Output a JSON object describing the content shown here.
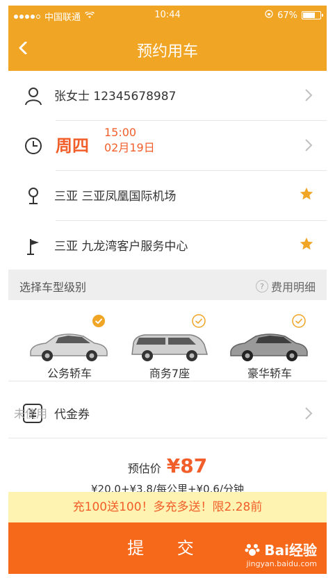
{
  "status_bar": {
    "carrier": "中国联通",
    "time": "10:44",
    "battery": "67%",
    "battery_level": 0.67
  },
  "header": {
    "title": "预约用车"
  },
  "rows": {
    "contact": {
      "text": "张女士  12345678987"
    },
    "datetime": {
      "weekday": "周四",
      "time": "15:00",
      "date": "02月19日"
    },
    "pickup": {
      "text": "三亚  三亚凤凰国际机场"
    },
    "dropoff": {
      "text": "三亚  九龙湾客户服务中心"
    }
  },
  "section": {
    "label": "选择车型级别",
    "fee_link": "费用明细"
  },
  "cars": [
    {
      "label": "公务轿车",
      "selected": true
    },
    {
      "label": "商务7座",
      "selected": false
    },
    {
      "label": "豪华轿车",
      "selected": false
    }
  ],
  "voucher": {
    "label": "代金券",
    "status": "未使用"
  },
  "estimate": {
    "label": "预估价",
    "price": "¥87",
    "formula": "¥20.0+¥3.8/每公里+¥0.6/分钟"
  },
  "promo": {
    "text": "充100送100！多充多送！限2.28前"
  },
  "submit": {
    "label": "提 交"
  },
  "watermark": {
    "brand": "Bai经验",
    "domain": "jingyan.baidu.com"
  },
  "colors": {
    "header": "#f1a525",
    "accent": "#f15e2a",
    "submit": "#f6691b",
    "promo_bg": "#fef3b0"
  }
}
